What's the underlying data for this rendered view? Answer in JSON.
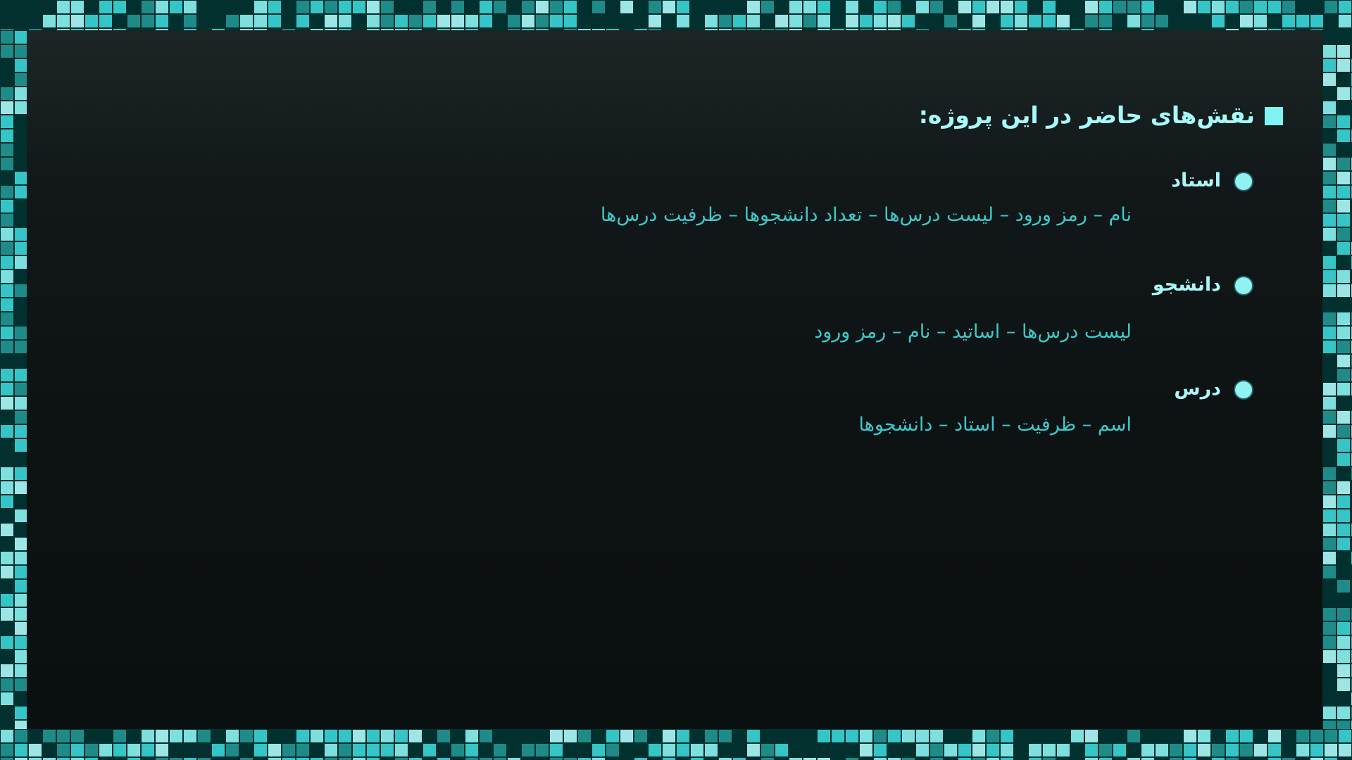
{
  "slide": {
    "heading": "نقش‌های حاضر در این پروژه:",
    "roles": [
      {
        "title": "استاد",
        "attributes": "نام – رمز ورود –  لیست درس‌ها – تعداد دانشجوها – ظرفیت درس‌ها"
      },
      {
        "title": "دانشجو",
        "attributes": "لیست درس‌ها – اساتید – نام – رمز ورود"
      },
      {
        "title": "درس",
        "attributes": "اسم – ظرفیت – استاد – دانشجوها"
      }
    ]
  },
  "theme": {
    "background": "#0c1011",
    "heading_color": "#a7fafa",
    "accent_square": "#80f3f3",
    "bullet_color": "#92f1f1",
    "attribute_color": "#3cc9cb",
    "border_palette": [
      "#02302f",
      "#1f8b88",
      "#36c5c6",
      "#7ddfde",
      "#9ee6e5"
    ]
  }
}
